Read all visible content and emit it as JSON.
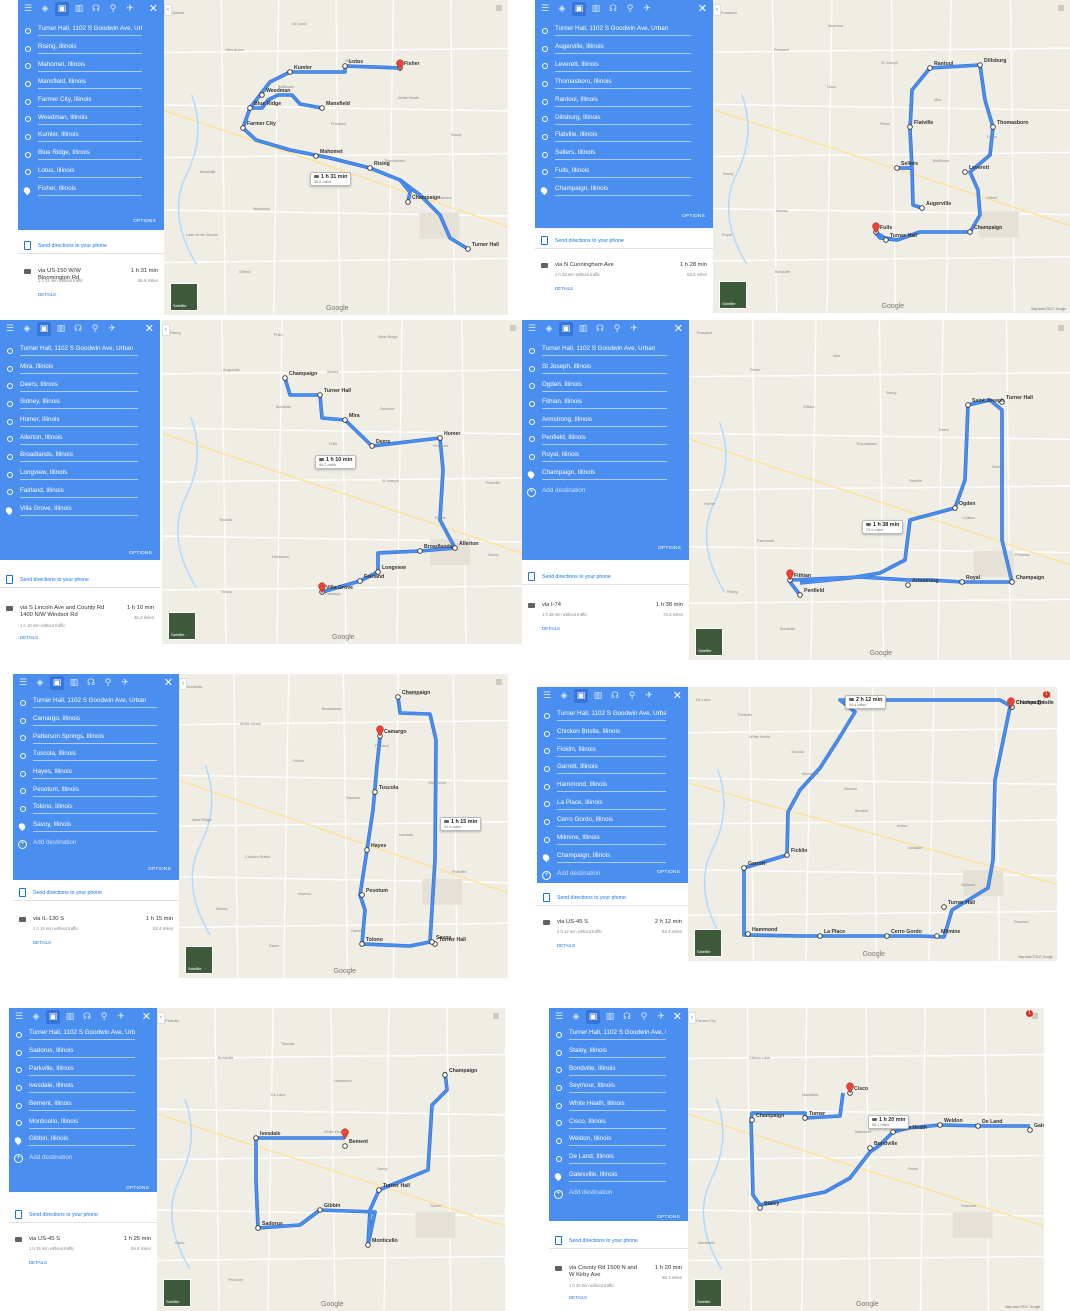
{
  "colors": {
    "panel_blue": "#4a8ef0",
    "route": "#4a8ef0",
    "pin": "#ea4335",
    "link": "#1a73e8"
  },
  "common": {
    "options_label": "OPTIONS",
    "send_label": "Send directions to your phone",
    "details_label": "DETAILS",
    "add_destination": "Add destination",
    "satellite_label": "Satellite",
    "google_logo": "Google",
    "map_data": "Map data ©2017 Google",
    "terms": "Terms",
    "send_feedback": "Send feedback"
  },
  "panels": [
    {
      "name": "Fisher",
      "stops": [
        "Turner Hall, 1102 S Goodwin Ave, Urban",
        "Rising, Illinois",
        "Mahomet, Illinois",
        "Mansfield, Illinois",
        "Farmer City, Illinois",
        "Weedman, Illinois",
        "Kumler, Illinois",
        "Blue Ridge, Illinois",
        "Lotus, Illinois",
        "Fisher, Illinois"
      ],
      "route": {
        "via": "via US-150 W/W Bloomington Rd",
        "duration": "1 h 31 min",
        "distance": "55.8 miles",
        "traffic": "1 h 31 min without traffic"
      },
      "callout": {
        "time": "1 h 31 min",
        "dist": "55.8 miles"
      },
      "map_labels": [
        "Fisher",
        "Lotus",
        "Kumler",
        "Weedman",
        "Blue Ridge",
        "Farmer City",
        "Mansfield",
        "Mahomet",
        "Rising",
        "Champaign",
        "Turner Hall",
        "Sabina",
        "Glen Arcon",
        "Bellflower",
        "Prospect",
        "Thomasboro",
        "Fullerton",
        "Lake of the Woods",
        "Gifford",
        "De Land",
        "Seymour",
        "White Heath",
        "Savoy",
        "Bondville",
        "Monticello"
      ]
    },
    {
      "name": "Champaign-Dillsburg",
      "stops": [
        "Turner Hall, 1102 S Goodwin Ave, Urban",
        "Augerville, Illinois",
        "Leverett, Illinois",
        "Thomasboro, Illinois",
        "Rantoul, Illinois",
        "Dillsburg, Illinois",
        "Flatville, Illinois",
        "Sellers, Illinois",
        "Fulls, Illinois",
        "Champaign, Illinois"
      ],
      "route": {
        "via": "via N Cunningham Ave",
        "duration": "1 h 28 min",
        "distance": "53.5 miles",
        "traffic": "1 h 28 min without traffic"
      },
      "callout": null,
      "map_labels": [
        "Rantoul",
        "Dillsburg",
        "Thomasboro",
        "Flatville",
        "Leverett",
        "Sellers",
        "Augerville",
        "Champaign",
        "Turner Hall",
        "Fulls",
        "Foosland",
        "Prospect",
        "Lotus",
        "Fisher",
        "Bellflower",
        "Gifford",
        "Royal",
        "Bondville",
        "Seymour",
        "St Joseph",
        "Mira",
        "Deers",
        "Savoy",
        "Sidney"
      ]
    },
    {
      "name": "Villa Grove",
      "stops": [
        "Turner Hall, 1102 S Goodwin Ave, Urban",
        "Mira, Illinois",
        "Deers, Illinois",
        "Sidney, Illinois",
        "Homer, Illinois",
        "Allerton, Illinois",
        "Broadlands, Illinois",
        "Longview, Illinois",
        "Fairland, Illinois",
        "Villa Grove, Illinois"
      ],
      "route": {
        "via": "via S Lincoln Ave and County Rd 1400 N/W Windsor Rd",
        "duration": "1 h 10 min",
        "distance": "46.2 miles",
        "traffic": "1 h 10 min without traffic"
      },
      "callout": {
        "time": "1 h 10 min",
        "dist": "46.2 miles"
      },
      "map_labels": [
        "Champaign",
        "Turner Hall",
        "Mira",
        "Deers",
        "Homer",
        "Allerton",
        "Broadlands",
        "Longview",
        "Fairland",
        "Villa Grove",
        "Rising",
        "Augerville",
        "Bondville",
        "Fulls",
        "St Joseph",
        "Fithian",
        "Savoy",
        "Tolono",
        "Philo",
        "Sidney",
        "Sadorus",
        "Pesotum",
        "Parkville",
        "Tuscola",
        "Hindsboro",
        "Camargo",
        "West Ridge"
      ]
    },
    {
      "name": "Champaign-Armstrong",
      "stops": [
        "Turner Hall, 1102 S Goodwin Ave, Urban",
        "St Joseph, Illinois",
        "Ogden, Illinois",
        "Fithian, Illinois",
        "Armstrong, Illinois",
        "Penfield, Illinois",
        "Royal, Illinois",
        "Champaign, Illinois"
      ],
      "route": {
        "via": "via I-74",
        "duration": "1 h 38 min",
        "distance": "72.6 miles",
        "traffic": "1 h 38 min without traffic"
      },
      "callout": {
        "time": "1 h 38 min",
        "dist": "72.6 miles"
      },
      "map_labels": [
        "Penfield",
        "Armstrong",
        "Royal",
        "Champaign",
        "Turner Hall",
        "Saint Joseph",
        "Ogden",
        "Fithian",
        "Prospect",
        "Fisher",
        "Gifford",
        "Thomasboro",
        "Flatville",
        "Collison",
        "Potomac",
        "Rising",
        "Bondville",
        "Mira",
        "Savoy",
        "Deers",
        "Sidney",
        "Homer",
        "Fairmount"
      ]
    },
    {
      "name": "Savoy",
      "stops": [
        "Turner Hall, 1102 S Goodwin Ave, Urban",
        "Camargo, Illinois",
        "Patterson Springs, Illinois",
        "Tuscola, Illinois",
        "Hayes, Illinois",
        "Pesotum, Illinois",
        "Tolono, Illinois",
        "Savoy, Illinois"
      ],
      "route": {
        "via": "via IL-130 S",
        "duration": "1 h 15 min",
        "distance": "52.4 miles",
        "traffic": "1 h 15 min without traffic"
      },
      "callout": {
        "time": "1 h 15 min",
        "dist": "52.4 miles"
      },
      "map_labels": [
        "Champaign",
        "Turner Hall",
        "Savoy",
        "Tolono",
        "Pesotum",
        "Hayes",
        "Tuscola",
        "Camargo",
        "Bondville",
        "White Heath",
        "Gibbin",
        "Sadorus",
        "Ivesdale",
        "Parkville",
        "Sidney",
        "Deers",
        "Broadlands",
        "Fairland",
        "Villa Grove",
        "West Ridge",
        "Chicken Bristle",
        "Atwood",
        "Garrett",
        "Hindsboro"
      ]
    },
    {
      "name": "Champaign-Milmine",
      "stops": [
        "Turner Hall, 1102 S Goodwin Ave, Urban",
        "Chicken Bristle, Illinois",
        "Ficklin, Illinois",
        "Garrett, Illinois",
        "Hammond, Illinois",
        "La Place, Illinois",
        "Cerro Gordo, Illinois",
        "Milmine, Illinois",
        "Champaign, Illinois"
      ],
      "route": {
        "via": "via US-45 S",
        "duration": "2 h 12 min",
        "distance": "94.4 miles",
        "traffic": "2 h 12 min without traffic"
      },
      "callout": {
        "time": "2 h 12 min",
        "dist": "94.4 miles"
      },
      "map_labels": [
        "Champaign",
        "Turner Hall",
        "Milmine",
        "Cerro Gordo",
        "La Place",
        "Hammond",
        "Garrett",
        "Ficklin",
        "Chicken Bristle",
        "De Land",
        "White Heath",
        "Monticello",
        "Bement",
        "Ivesdale",
        "Sadorus",
        "Pesotum",
        "Parkville",
        "Tuscola",
        "Atwood",
        "Arthur"
      ]
    },
    {
      "name": "Gibbin",
      "stops": [
        "Turner Hall, 1102 S Goodwin Ave, Urban",
        "Sadorus, Illinois",
        "Parkville, Illinois",
        "Ivesdale, Illinois",
        "Bement, Illinois",
        "Monticello, Illinois",
        "Gibbin, Illinois"
      ],
      "route": {
        "via": "via US-45 S",
        "duration": "1 h 25 min",
        "distance": "54.6 miles",
        "traffic": "1 h 25 min without traffic"
      },
      "callout": null,
      "map_labels": [
        "Champaign",
        "Turner Hall",
        "Monticello",
        "Gibbin",
        "Sadorus",
        "Ivesdale",
        "Bement",
        "Parkville",
        "Bondville",
        "De Land",
        "White Heath",
        "Savoy",
        "Tolono",
        "Cisco",
        "Pesotum",
        "Tuscola",
        "Hammond"
      ]
    },
    {
      "name": "Galesville",
      "stops": [
        "Turner Hall, 1102 S Goodwin Ave, Urban",
        "Staley, Illinois",
        "Bondville, Illinois",
        "Seymour, Illinois",
        "White Heath, Illinois",
        "Cisco, Illinois",
        "Weldon, Illinois",
        "De Land, Illinois",
        "Galesville, Illinois"
      ],
      "route": {
        "via": "via County Rd 1500 N and W Kirby Ave",
        "duration": "1 h 20 min",
        "distance": "56.1 miles",
        "traffic": "1 h 20 min without traffic"
      },
      "callout": {
        "time": "1 h 20 min",
        "dist": "56.1 miles"
      },
      "map_labels": [
        "Galesville",
        "De Land",
        "Weldon",
        "White Heath",
        "Bondville",
        "Staley",
        "Champaign",
        "Turner",
        "Cisco",
        "Farmer City",
        "Clinton Lake",
        "Mansfield",
        "Mahomet",
        "Fisher",
        "Seymour",
        "Monticello"
      ]
    }
  ]
}
